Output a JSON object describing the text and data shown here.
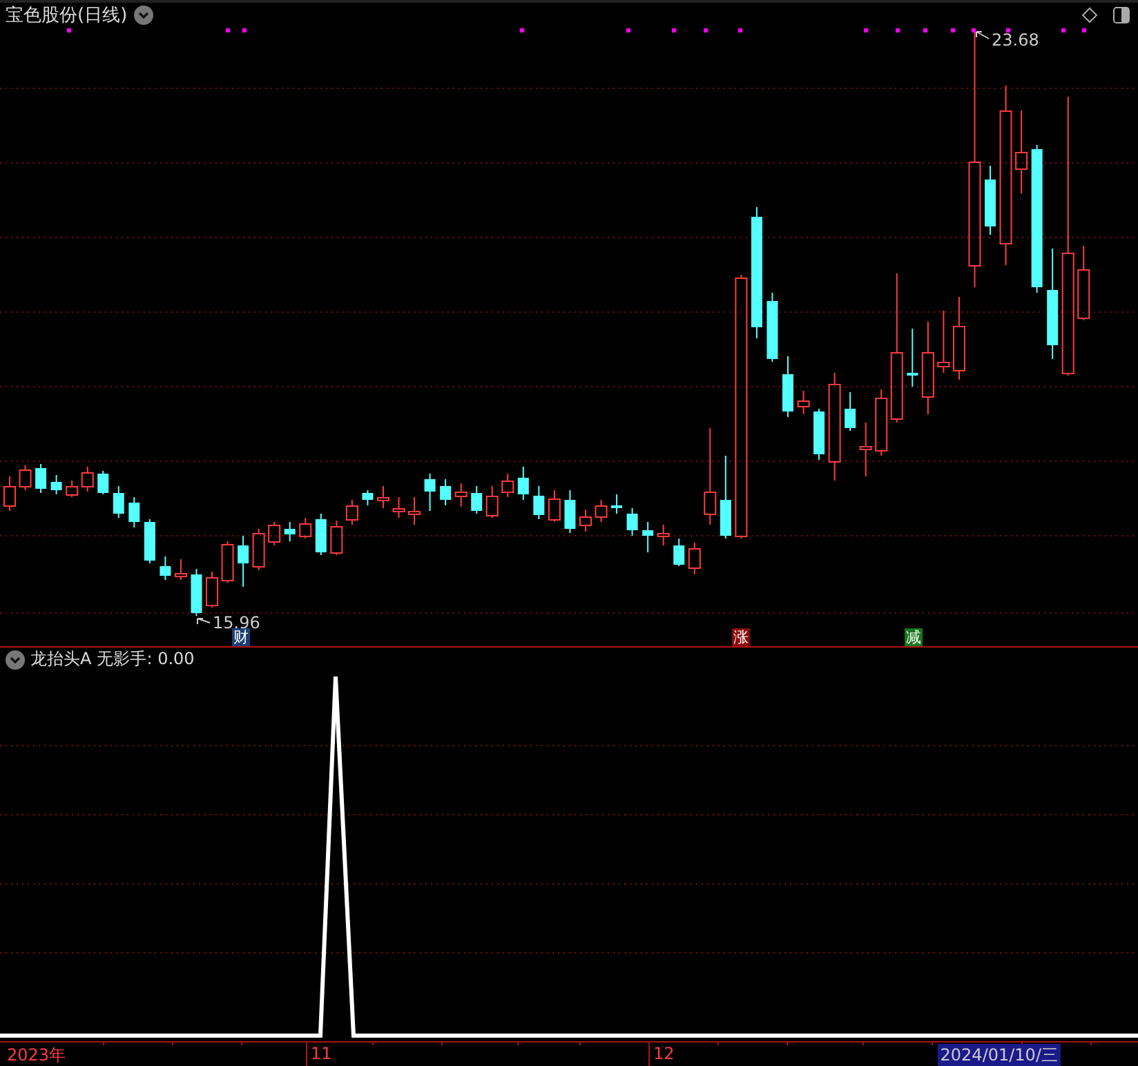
{
  "main_panel": {
    "title": "宝色股份(日线)",
    "high_label": "23.68",
    "low_label": "15.96",
    "markers": [
      {
        "text": "财",
        "color": "#1c3f73"
      },
      {
        "text": "涨",
        "color": "#8c0a0a"
      },
      {
        "text": "减",
        "color": "#19751e"
      }
    ]
  },
  "indicator_panel": {
    "name": "龙抬头A",
    "reading": "无影手: 0.00"
  },
  "time_axis": {
    "labels": [
      "2023年",
      "11",
      "12"
    ],
    "current_date": "2024/01/10/三"
  }
}
